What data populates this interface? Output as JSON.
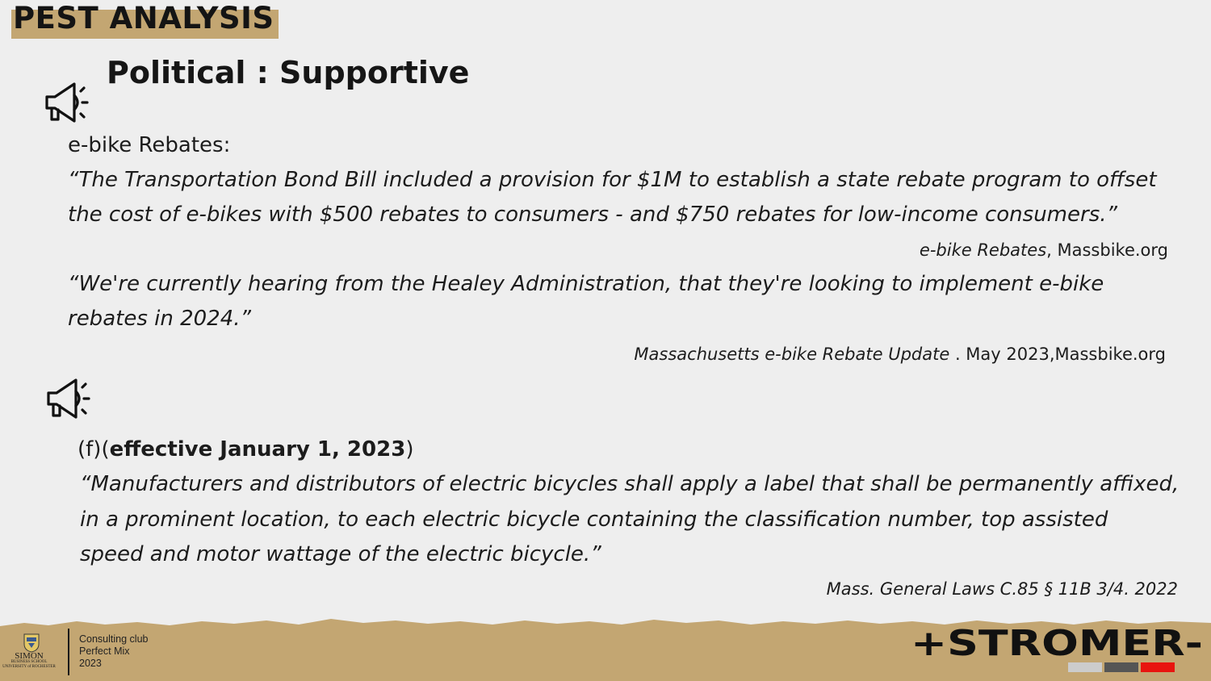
{
  "header": {
    "title": "PEST ANALYSIS",
    "subtitle": "Political : Supportive"
  },
  "icons": {
    "section1": "megaphone-icon",
    "section2": "megaphone-icon"
  },
  "section1": {
    "label": "e-bike Rebates:",
    "quote1": {
      "line1": "“The Transportation Bond Bill included a provision for $1M to establish a state rebate program to offset",
      "line2": "the cost of e-bikes with $500 rebates to consumers - and $750 rebates for low-income consumers.”",
      "source_title": "e-bike Rebates",
      "source_rest": ", Massbike.org"
    },
    "quote2": {
      "line1": "“We're currently hearing from the Healey Administration, that they're looking to implement e-bike",
      "line2": "rebates in 2024.”",
      "source_title": "Massachusetts e-bike Rebate Update",
      "source_rest": " . May 2023,Massbike.org"
    }
  },
  "section2": {
    "label_prefix": "(f)(",
    "label_bold": "effective January 1, 2023",
    "label_suffix": ")",
    "quote": {
      "line1": "“Manufacturers and distributors of electric bicycles shall apply a label that shall be permanently affixed,",
      "line2": "in a prominent location, to each electric bicycle containing the classification number, top assisted",
      "line3": "speed and motor wattage of the electric bicycle.”",
      "source": "Mass. General Laws C.85 § 11B 3/4. 2022"
    }
  },
  "footer": {
    "org_line1": "Consulting club",
    "org_line2": "Perfect Mix",
    "org_line3": "2023",
    "school_name": "SIMON",
    "school_sub1": "BUSINESS SCHOOL",
    "school_sub2": "UNIVERSITY of ROCHESTER",
    "brand": "+STROMER-"
  },
  "colors": {
    "background": "#eeeeee",
    "accent_gold": "#c3a672",
    "text": "#1c1c1c",
    "brand_bar_light": "#cccccc",
    "brand_bar_dark": "#555555",
    "brand_bar_red": "#e8140f"
  }
}
